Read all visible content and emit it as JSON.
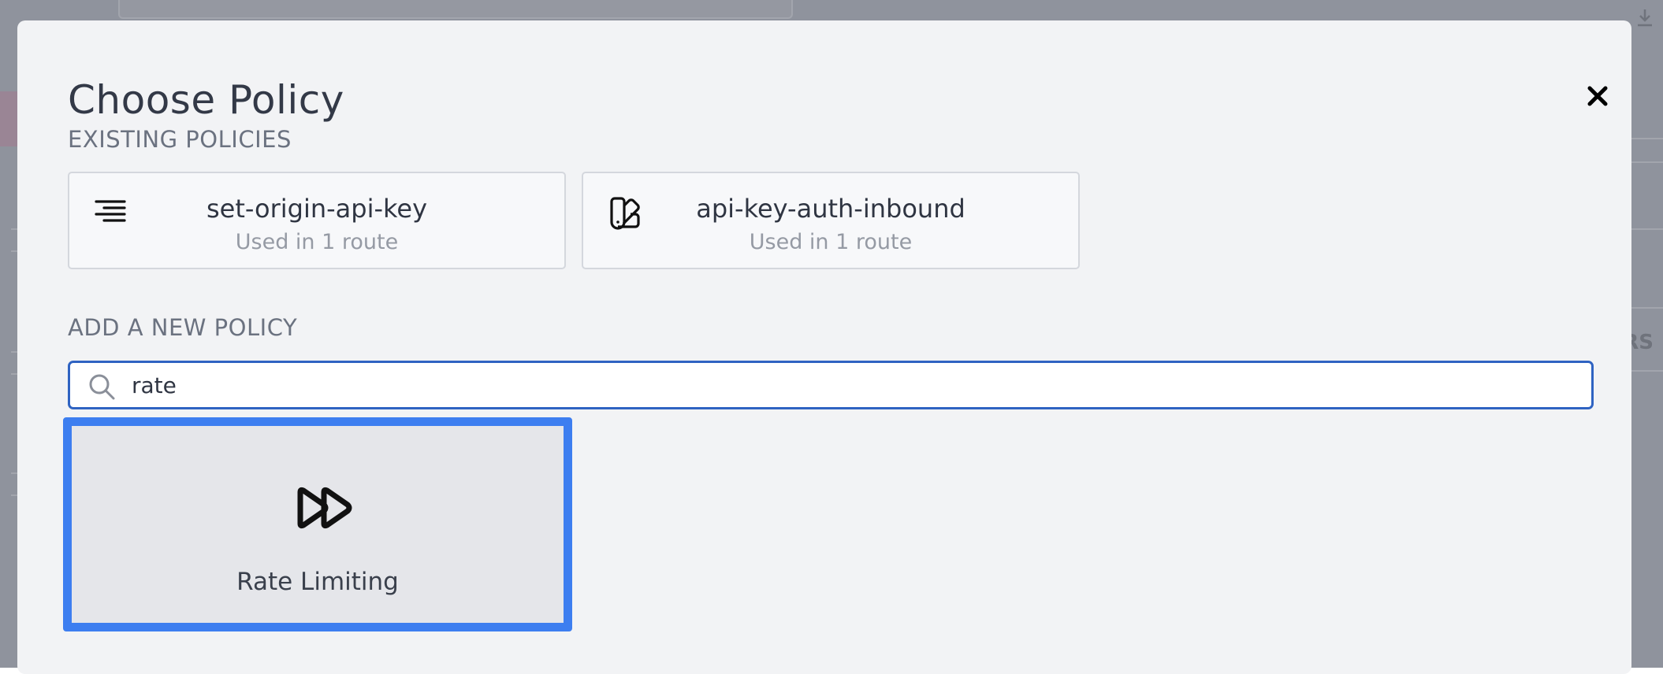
{
  "modal": {
    "title": "Choose Policy",
    "close_symbol": "×"
  },
  "existing": {
    "label": "EXISTING POLICIES",
    "policies": [
      {
        "name": "set-origin-api-key",
        "usage": "Used in 1 route",
        "icon": "align-right-icon"
      },
      {
        "name": "api-key-auth-inbound",
        "usage": "Used in 1 route",
        "icon": "swatch-book-icon"
      }
    ]
  },
  "add_new": {
    "label": "ADD A NEW POLICY",
    "search": {
      "value": "rate",
      "icon": "search-icon"
    },
    "results": [
      {
        "name": "Rate Limiting",
        "icon": "fast-forward-icon"
      }
    ]
  },
  "background": {
    "partial_text": "RS"
  },
  "colors": {
    "accent": "#3d7ef0",
    "search_border": "#2f63c2",
    "overlay": "#8f939d",
    "modal_bg": "#f2f3f5"
  }
}
